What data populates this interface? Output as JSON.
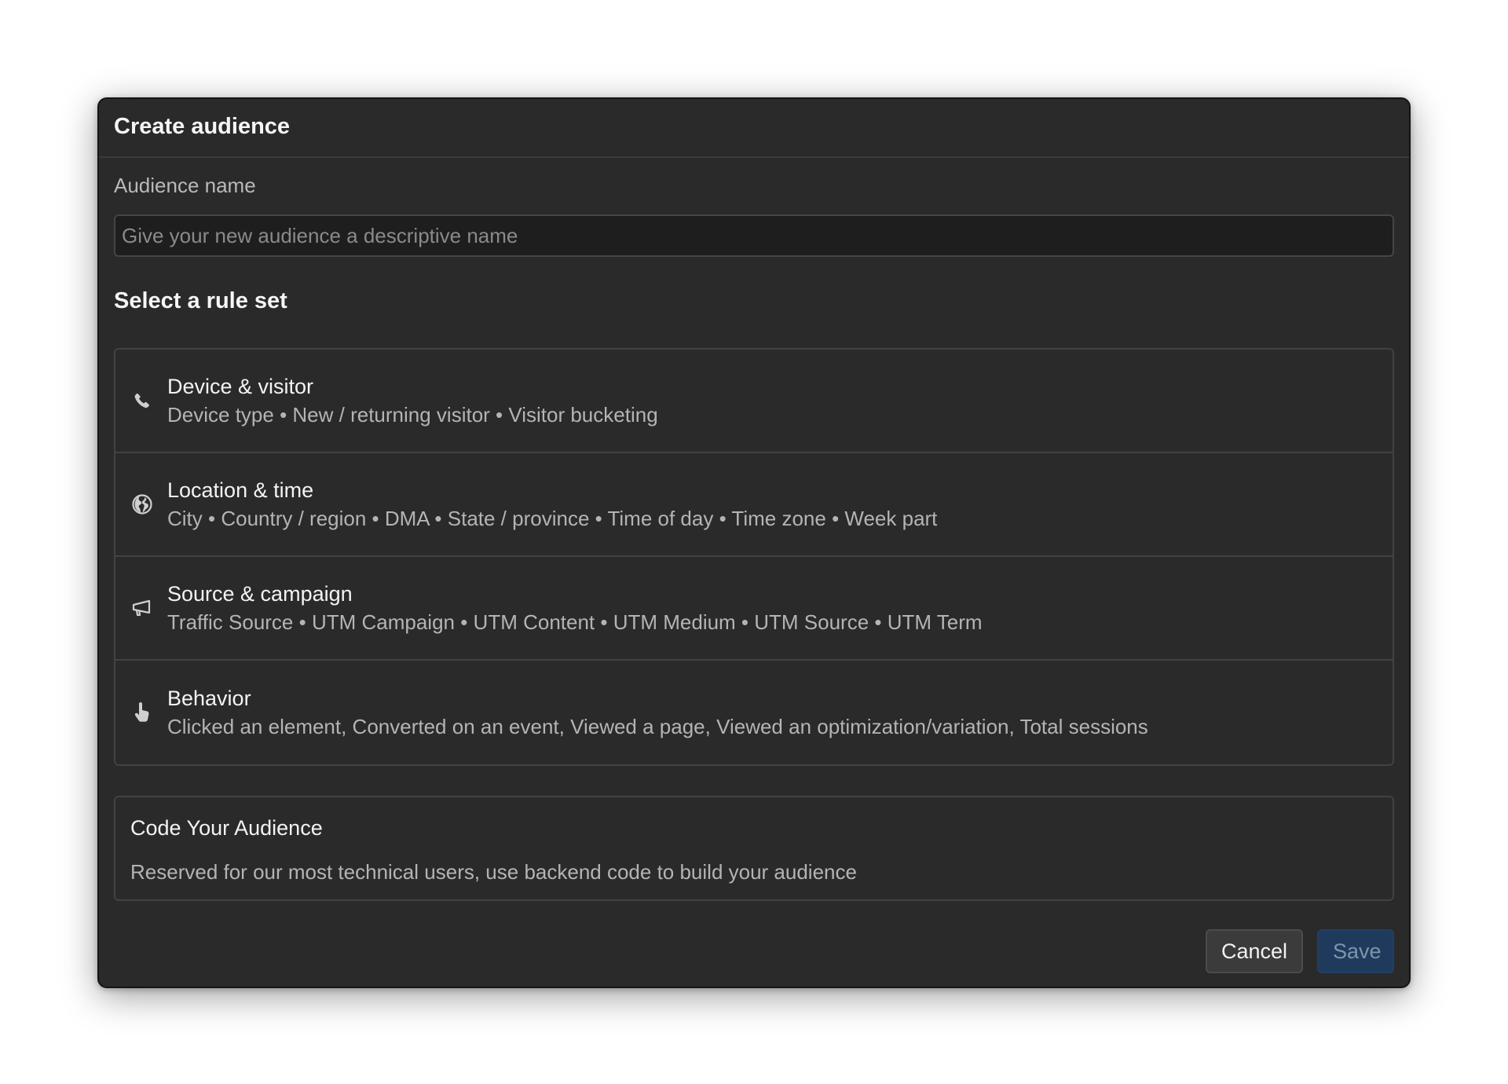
{
  "modal": {
    "title": "Create audience"
  },
  "audience_name": {
    "label": "Audience name",
    "value": "",
    "placeholder": "Give your new audience a descriptive name"
  },
  "rule_sets": {
    "title": "Select a rule set",
    "items": [
      {
        "title": "Device & visitor",
        "description": "Device type • New / returning visitor • Visitor bucketing",
        "icon": "phone-icon"
      },
      {
        "title": "Location & time",
        "description": "City • Country / region • DMA • State / province • Time of day • Time zone • Week part",
        "icon": "globe-icon"
      },
      {
        "title": "Source & campaign",
        "description": "Traffic Source • UTM Campaign • UTM Content • UTM Medium • UTM Source • UTM Term",
        "icon": "megaphone-icon"
      },
      {
        "title": "Behavior",
        "description": "Clicked an element, Converted on an event, Viewed a page, Viewed an optimization/variation, Total sessions",
        "icon": "pointer-hand-icon"
      }
    ]
  },
  "code_audience": {
    "title": "Code Your Audience",
    "description": "Reserved for our most technical users, use backend code to build your audience"
  },
  "footer": {
    "cancel_label": "Cancel",
    "save_label": "Save"
  },
  "colors": {
    "modal_background": "#2a2a2a",
    "save_button": "#1f3a5c",
    "cancel_button": "#3b3b3b"
  }
}
